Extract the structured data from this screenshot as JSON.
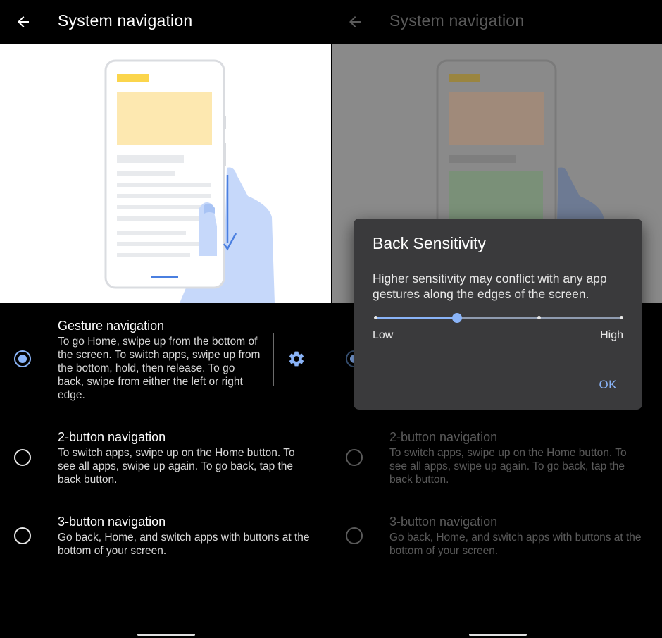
{
  "app": {
    "title": "System navigation"
  },
  "options": [
    {
      "title": "Gesture navigation",
      "description": "To go Home, swipe up from the bottom of the screen. To switch apps, swipe up from the bottom, hold, then release. To go back, swipe from either the left or right edge.",
      "selected": true
    },
    {
      "title": "2-button navigation",
      "description": "To switch apps, swipe up on the Home button. To see all apps, swipe up again. To go back, tap the back button.",
      "selected": false
    },
    {
      "title": "3-button navigation",
      "description": "Go back, Home, and switch apps with buttons at the bottom of your screen.",
      "selected": false
    }
  ],
  "dialog": {
    "title": "Back Sensitivity",
    "text": "Higher sensitivity may conflict with any app gestures along the edges of the screen.",
    "slider": {
      "low_label": "Low",
      "high_label": "High",
      "steps": 4,
      "value_index": 1
    },
    "ok_label": "OK"
  },
  "colors": {
    "accent": "#8ab4f8",
    "background": "#000000",
    "dialog_background": "#3a3a3c",
    "illustration_yellow": "#fde293",
    "illustration_hand": "#c6d8fa"
  },
  "icons": {
    "back": "arrow-back-icon",
    "settings": "gear-icon"
  }
}
